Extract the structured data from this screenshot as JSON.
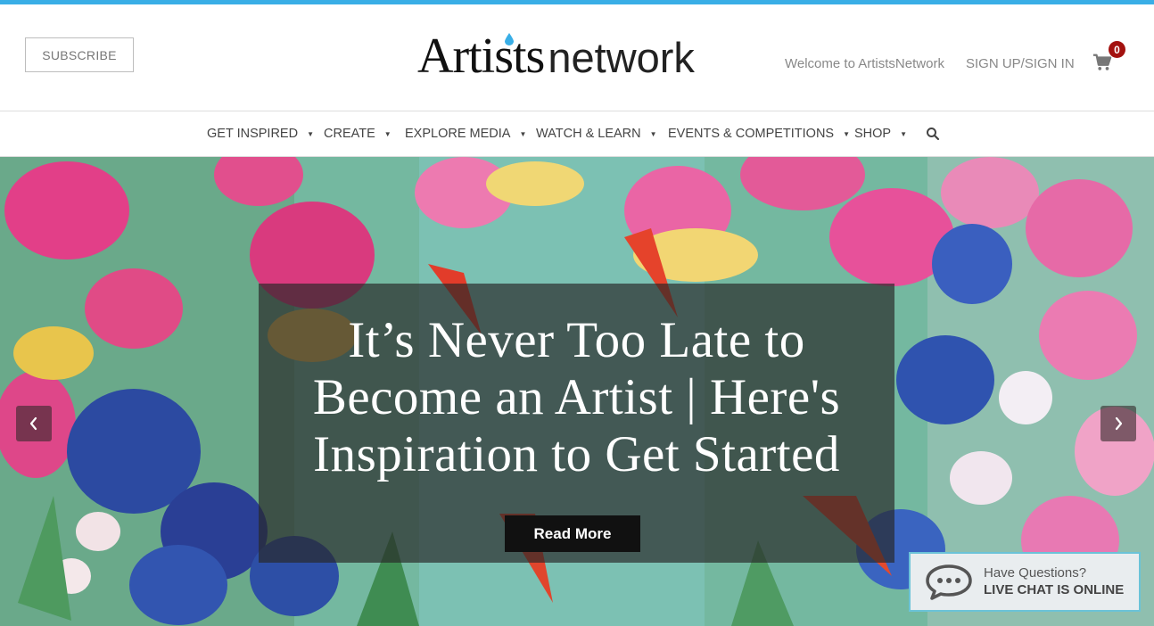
{
  "header": {
    "subscribe_label": "SUBSCRIBE",
    "logo_artists": "Artists",
    "logo_network": "network",
    "welcome_text": "Welcome to ArtistsNetwork",
    "signin_label": "SIGN UP/SIGN IN",
    "cart_count": "0",
    "cart_icon": "shopping-cart-icon"
  },
  "nav": {
    "items": [
      {
        "label": "GET INSPIRED"
      },
      {
        "label": "CREATE"
      },
      {
        "label": "EXPLORE MEDIA"
      },
      {
        "label": "WATCH & LEARN"
      },
      {
        "label": "EVENTS & COMPETITIONS"
      },
      {
        "label": "SHOP"
      }
    ],
    "search_icon": "search-icon"
  },
  "hero": {
    "title": "It’s Never Too Late to Become an Artist | Here's Inspiration to Get Started",
    "read_more_label": "Read More",
    "prev_icon": "chevron-left-icon",
    "next_icon": "chevron-right-icon"
  },
  "chat": {
    "line1": "Have Questions?",
    "line2": "LIVE CHAT IS ONLINE",
    "icon": "chat-bubble-icon"
  },
  "colors": {
    "accent_stripe": "#39aee6",
    "cart_badge": "#a3110f",
    "chat_border": "#6bc3d8"
  }
}
